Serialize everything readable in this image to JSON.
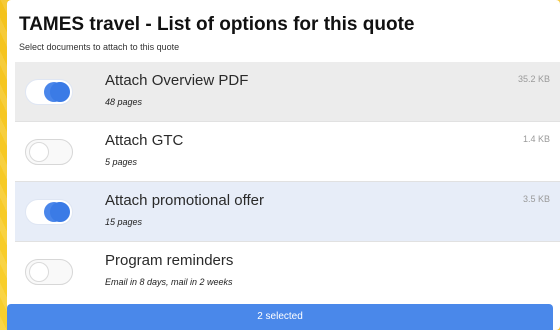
{
  "dialog": {
    "title": "TAMES travel - List of options for this quote",
    "subtitle": "Select documents to attach to this quote"
  },
  "items": [
    {
      "label": "Attach Overview PDF",
      "detail": "48 pages",
      "size": "35.2 KB",
      "enabled": true
    },
    {
      "label": "Attach GTC",
      "detail": "5 pages",
      "size": "1.4 KB",
      "enabled": false
    },
    {
      "label": "Attach promotional offer",
      "detail": "15 pages",
      "size": "3.5 KB",
      "enabled": true
    },
    {
      "label": "Program reminders",
      "detail": "Email in 8 days, mail in 2 weeks",
      "size": "",
      "enabled": false
    }
  ],
  "footer": {
    "selected_label": "2 selected"
  },
  "colors": {
    "accent": "#3b7be6",
    "background": "#f6c52a",
    "selected_row": "#e7edf8"
  }
}
